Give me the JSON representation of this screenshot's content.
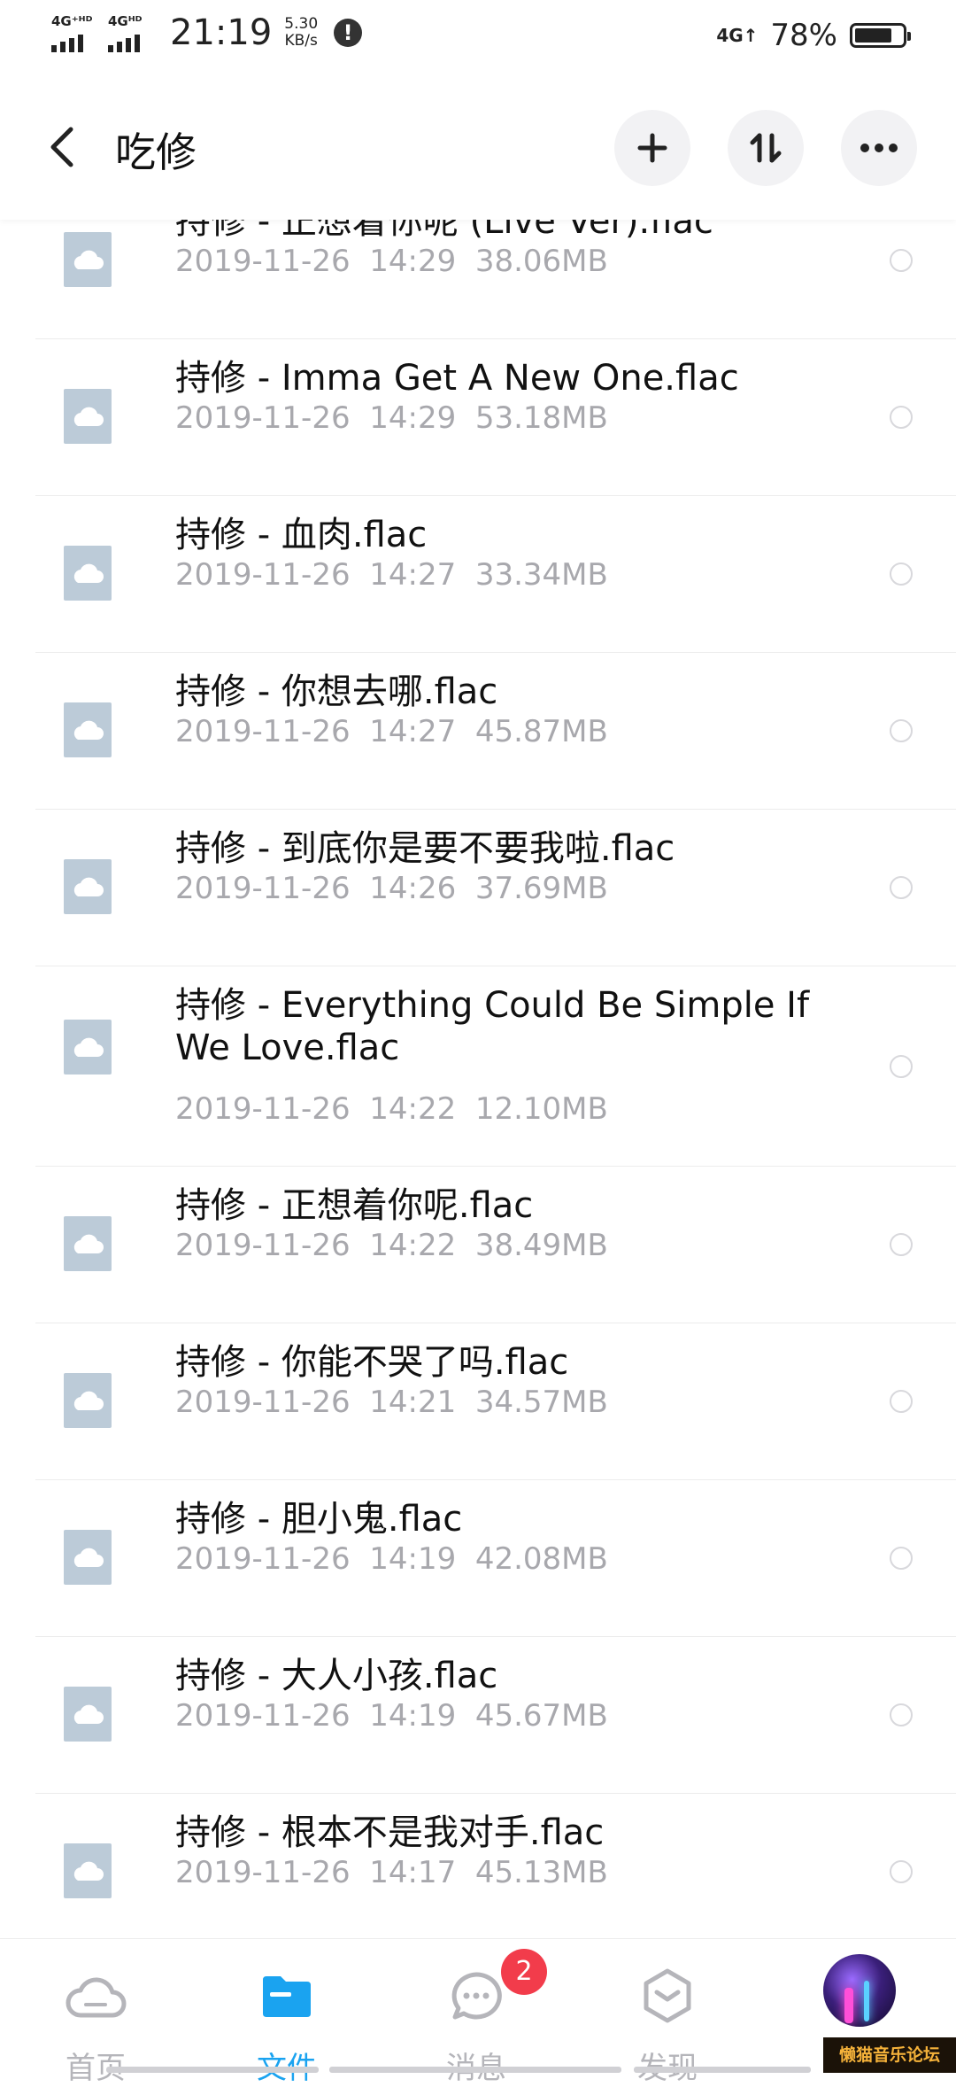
{
  "status_bar": {
    "sim1_label": "4G⁺ᴴᴰ",
    "sim2_label": "4Gᴴᴰ",
    "time": "21:19",
    "speed_value": "5.30",
    "speed_unit": "KB/s",
    "alert_symbol": "!",
    "network": "4G↑",
    "battery_text": "78%",
    "battery_level": 0.78
  },
  "header": {
    "title": "吃修",
    "back_icon": "chevron-left-icon",
    "add_icon": "plus-icon",
    "sort_icon": "sort-icon",
    "more_icon": "more-dots-icon"
  },
  "files": [
    {
      "name": "持修 - 正想着你呢 (Live Ver).flac",
      "date": "2019-11-26",
      "time": "14:29",
      "size": "38.06MB"
    },
    {
      "name": "持修 - Imma Get A New One.flac",
      "date": "2019-11-26",
      "time": "14:29",
      "size": "53.18MB"
    },
    {
      "name": "持修 - 血肉.flac",
      "date": "2019-11-26",
      "time": "14:27",
      "size": "33.34MB"
    },
    {
      "name": "持修 - 你想去哪.flac",
      "date": "2019-11-26",
      "time": "14:27",
      "size": "45.87MB"
    },
    {
      "name": "持修 - 到底你是要不要我啦.flac",
      "date": "2019-11-26",
      "time": "14:26",
      "size": "37.69MB"
    },
    {
      "name": "持修 - Everything Could Be Simple If We Love.flac",
      "date": "2019-11-26",
      "time": "14:22",
      "size": "12.10MB"
    },
    {
      "name": "持修 - 正想着你呢.flac",
      "date": "2019-11-26",
      "time": "14:22",
      "size": "38.49MB"
    },
    {
      "name": "持修 - 你能不哭了吗.flac",
      "date": "2019-11-26",
      "time": "14:21",
      "size": "34.57MB"
    },
    {
      "name": "持修 - 胆小鬼.flac",
      "date": "2019-11-26",
      "time": "14:19",
      "size": "42.08MB"
    },
    {
      "name": "持修 - 大人小孩.flac",
      "date": "2019-11-26",
      "time": "14:19",
      "size": "45.67MB"
    },
    {
      "name": "持修 - 根本不是我对手.flac",
      "date": "2019-11-26",
      "time": "14:17",
      "size": "45.13MB"
    }
  ],
  "tabs": [
    {
      "label": "首页",
      "icon": "cloud-icon",
      "active": false
    },
    {
      "label": "文件",
      "icon": "folder-icon",
      "active": true
    },
    {
      "label": "消息",
      "icon": "message-icon",
      "active": false,
      "badge": "2"
    },
    {
      "label": "发现",
      "icon": "discover-icon",
      "active": false
    }
  ],
  "watermark": "懒猫音乐论坛",
  "colors": {
    "accent": "#1aa3f0",
    "file_icon": "#bccbd8",
    "meta_text": "#a8a8ad",
    "badge": "#f23c4b"
  }
}
